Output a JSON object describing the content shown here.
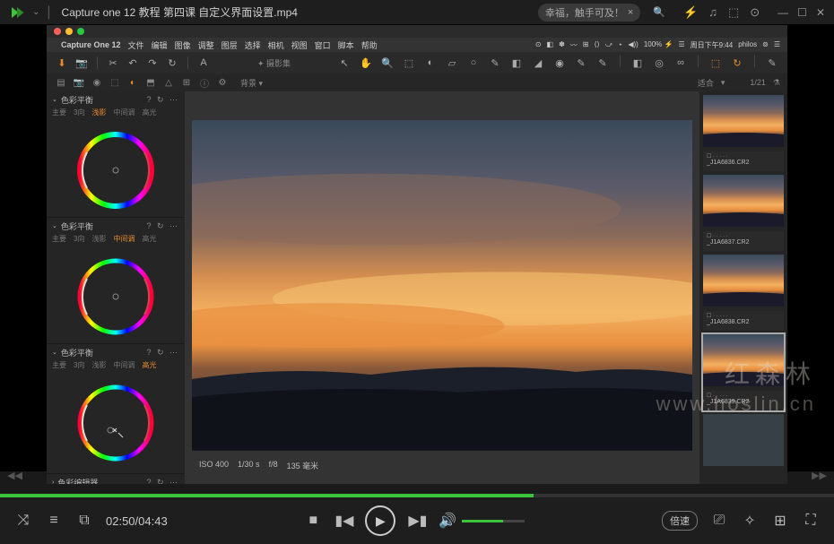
{
  "player": {
    "title": "Capture one 12 教程 第四课 自定义界面设置.mp4",
    "search_text": "幸福，触手可及！",
    "time_current": "02:50",
    "time_total": "04:43",
    "progress_pct": 64,
    "speed_label": "倍速"
  },
  "macbar": {
    "apple": "",
    "app": "Capture One 12",
    "menus": [
      "文件",
      "编辑",
      "图像",
      "调整",
      "图层",
      "选择",
      "相机",
      "视图",
      "窗口",
      "脚本",
      "帮助"
    ],
    "right": [
      "⊙",
      "◧",
      "✽",
      "〰",
      "⊞",
      "⟨⟩",
      "⤻",
      "⋆",
      "◀))",
      "100% ⚡",
      "☰",
      "周日下午9:44",
      "philos",
      "⊚",
      "☰"
    ]
  },
  "toolbar1": {
    "center": "✦ 摄影集"
  },
  "toolbar2": {
    "dropdown": "背景",
    "fit_label": "适合",
    "counter": "1/21"
  },
  "panels": {
    "p1": {
      "title": "色彩平衡",
      "tabs": [
        "主要",
        "3向",
        "浅影",
        "中间调",
        "高光"
      ],
      "active": 2
    },
    "p2": {
      "title": "色彩平衡",
      "tabs": [
        "主要",
        "3向",
        "浅影",
        "中间调",
        "高光"
      ],
      "active": 3
    },
    "p3": {
      "title": "色彩平衡",
      "tabs": [
        "主要",
        "3向",
        "浅影",
        "中间调",
        "高光"
      ],
      "active": 4
    },
    "p4": {
      "title": "色彩编辑器"
    }
  },
  "info": {
    "iso": "ISO 400",
    "shutter": "1/30 s",
    "focal": "f/8",
    "lens": "135 毫米"
  },
  "thumbs": [
    {
      "file": "_J1A6836.CR2"
    },
    {
      "file": "_J1A6837.CR2"
    },
    {
      "file": "_J1A6838.CR2"
    },
    {
      "file": "_J1A6839.CR2"
    }
  ],
  "watermark": {
    "cn": "红森林",
    "url": "www.hoslin.cn"
  }
}
